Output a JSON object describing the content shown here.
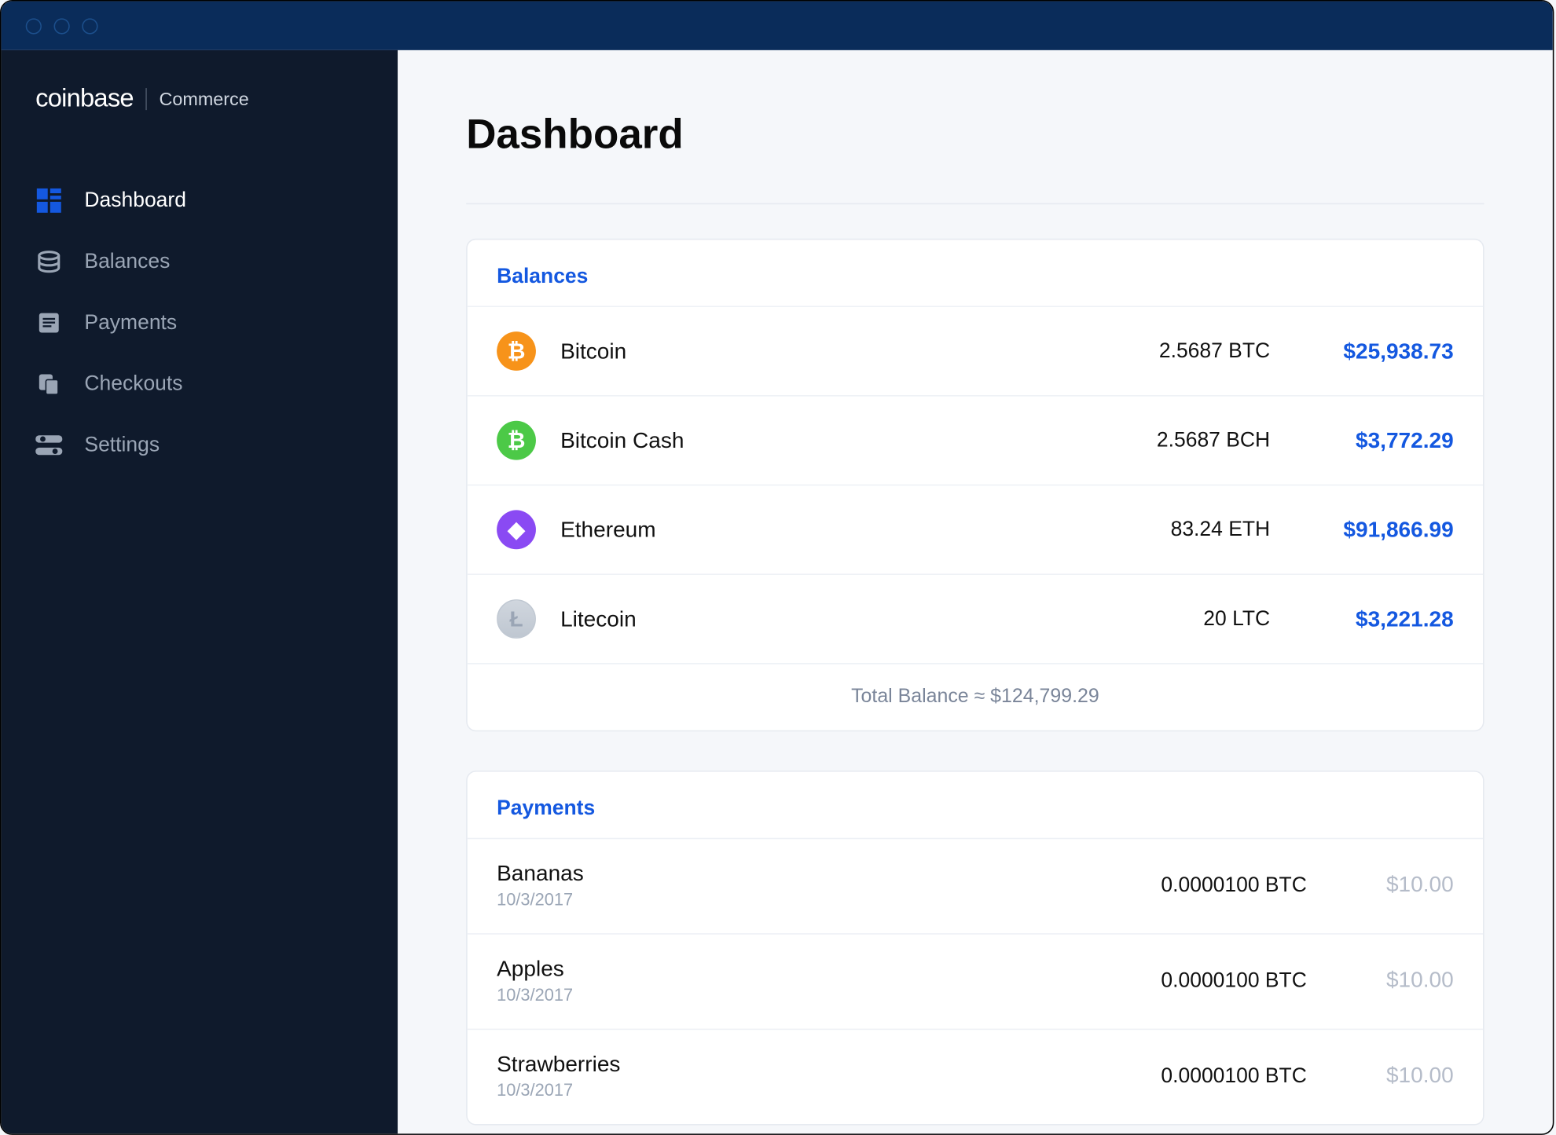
{
  "brand": {
    "main": "coinbase",
    "sub": "Commerce"
  },
  "sidebar": {
    "items": [
      {
        "label": "Dashboard",
        "icon": "dashboard-icon",
        "active": true
      },
      {
        "label": "Balances",
        "icon": "balances-icon",
        "active": false
      },
      {
        "label": "Payments",
        "icon": "payments-icon",
        "active": false
      },
      {
        "label": "Checkouts",
        "icon": "checkouts-icon",
        "active": false
      },
      {
        "label": "Settings",
        "icon": "settings-icon",
        "active": false
      }
    ]
  },
  "page": {
    "title": "Dashboard"
  },
  "balances": {
    "title": "Balances",
    "rows": [
      {
        "name": "Bitcoin",
        "symbol": "₿",
        "color": "c-btc",
        "amount": "2.5687 BTC",
        "usd": "$25,938.73"
      },
      {
        "name": "Bitcoin Cash",
        "symbol": "₿",
        "color": "c-bch",
        "amount": "2.5687 BCH",
        "usd": "$3,772.29"
      },
      {
        "name": "Ethereum",
        "symbol": "◆",
        "color": "c-eth",
        "amount": "83.24 ETH",
        "usd": "$91,866.99"
      },
      {
        "name": "Litecoin",
        "symbol": "Ł",
        "color": "c-ltc",
        "amount": "20 LTC",
        "usd": "$3,221.28"
      }
    ],
    "total_label": "Total Balance ≈ ",
    "total_value": "$124,799.29"
  },
  "payments": {
    "title": "Payments",
    "rows": [
      {
        "name": "Bananas",
        "date": "10/3/2017",
        "amount": "0.0000100 BTC",
        "usd": "$10.00"
      },
      {
        "name": "Apples",
        "date": "10/3/2017",
        "amount": "0.0000100 BTC",
        "usd": "$10.00"
      },
      {
        "name": "Strawberries",
        "date": "10/3/2017",
        "amount": "0.0000100 BTC",
        "usd": "$10.00"
      }
    ]
  }
}
